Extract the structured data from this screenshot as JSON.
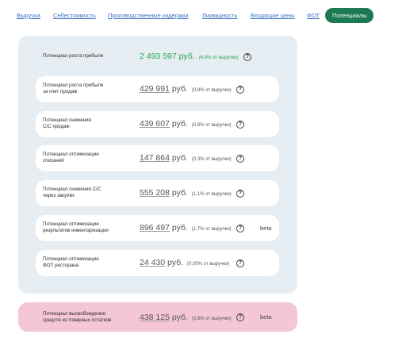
{
  "tabs": [
    {
      "label": "Выручка",
      "active": false
    },
    {
      "label": "Себестоимость",
      "active": false
    },
    {
      "label": "Производственные издержки",
      "active": false
    },
    {
      "label": "Ликвидность",
      "active": false
    },
    {
      "label": "Входящие цены",
      "active": false
    },
    {
      "label": "ФОТ",
      "active": false
    },
    {
      "label": "Потенциалы",
      "active": true
    }
  ],
  "summary": {
    "label": "Потенциал роста прибыли",
    "amount": "2 493 597",
    "currency": "руб.",
    "pct": "(4,8% от выручки)",
    "help": "?"
  },
  "items": [
    {
      "label": "Потенциал роста прибыли\nза счет продаж",
      "amount": "429 991",
      "currency": "руб.",
      "pct": "(0,8% от выручки)",
      "help": "?",
      "beta": ""
    },
    {
      "label": "Потенциал снижения\nС/С продаж",
      "amount": "439 607",
      "currency": "руб.",
      "pct": "(0,8% от выручки)",
      "help": "?",
      "beta": ""
    },
    {
      "label": "Потенциал оптимизации\nсписаний",
      "amount": "147 864",
      "currency": "руб.",
      "pct": "(0,3% от выручки)",
      "help": "?",
      "beta": ""
    },
    {
      "label": "Потенциал снижения С/С\nчерез закупки",
      "amount": "555 208",
      "currency": "руб.",
      "pct": "(1,1% от выручки)",
      "help": "?",
      "beta": ""
    },
    {
      "label": "Потенциал оптимизации\nрезультатов инвентаризации",
      "amount": "896 497",
      "currency": "руб.",
      "pct": "(1,7% от выручки)",
      "help": "?",
      "beta": "beta"
    },
    {
      "label": "Потенциал оптимизации\nФОТ ресторана",
      "amount": "24 430",
      "currency": "руб.",
      "pct": "(0,05% от выручки)",
      "help": "?",
      "beta": ""
    }
  ],
  "inventory": {
    "label": "Потенциал высвобождения\nсредств из товарных остатков",
    "amount": "438 125",
    "currency": "руб.",
    "pct": "(0,8% от выручки)",
    "help": "?",
    "beta": "beta"
  },
  "colors": {
    "accent": "#1b7a52",
    "link": "#3b74c4",
    "positive": "#2aa84a",
    "panel_bg": "#e6edf3",
    "pink_bg": "#f5c6d3"
  }
}
